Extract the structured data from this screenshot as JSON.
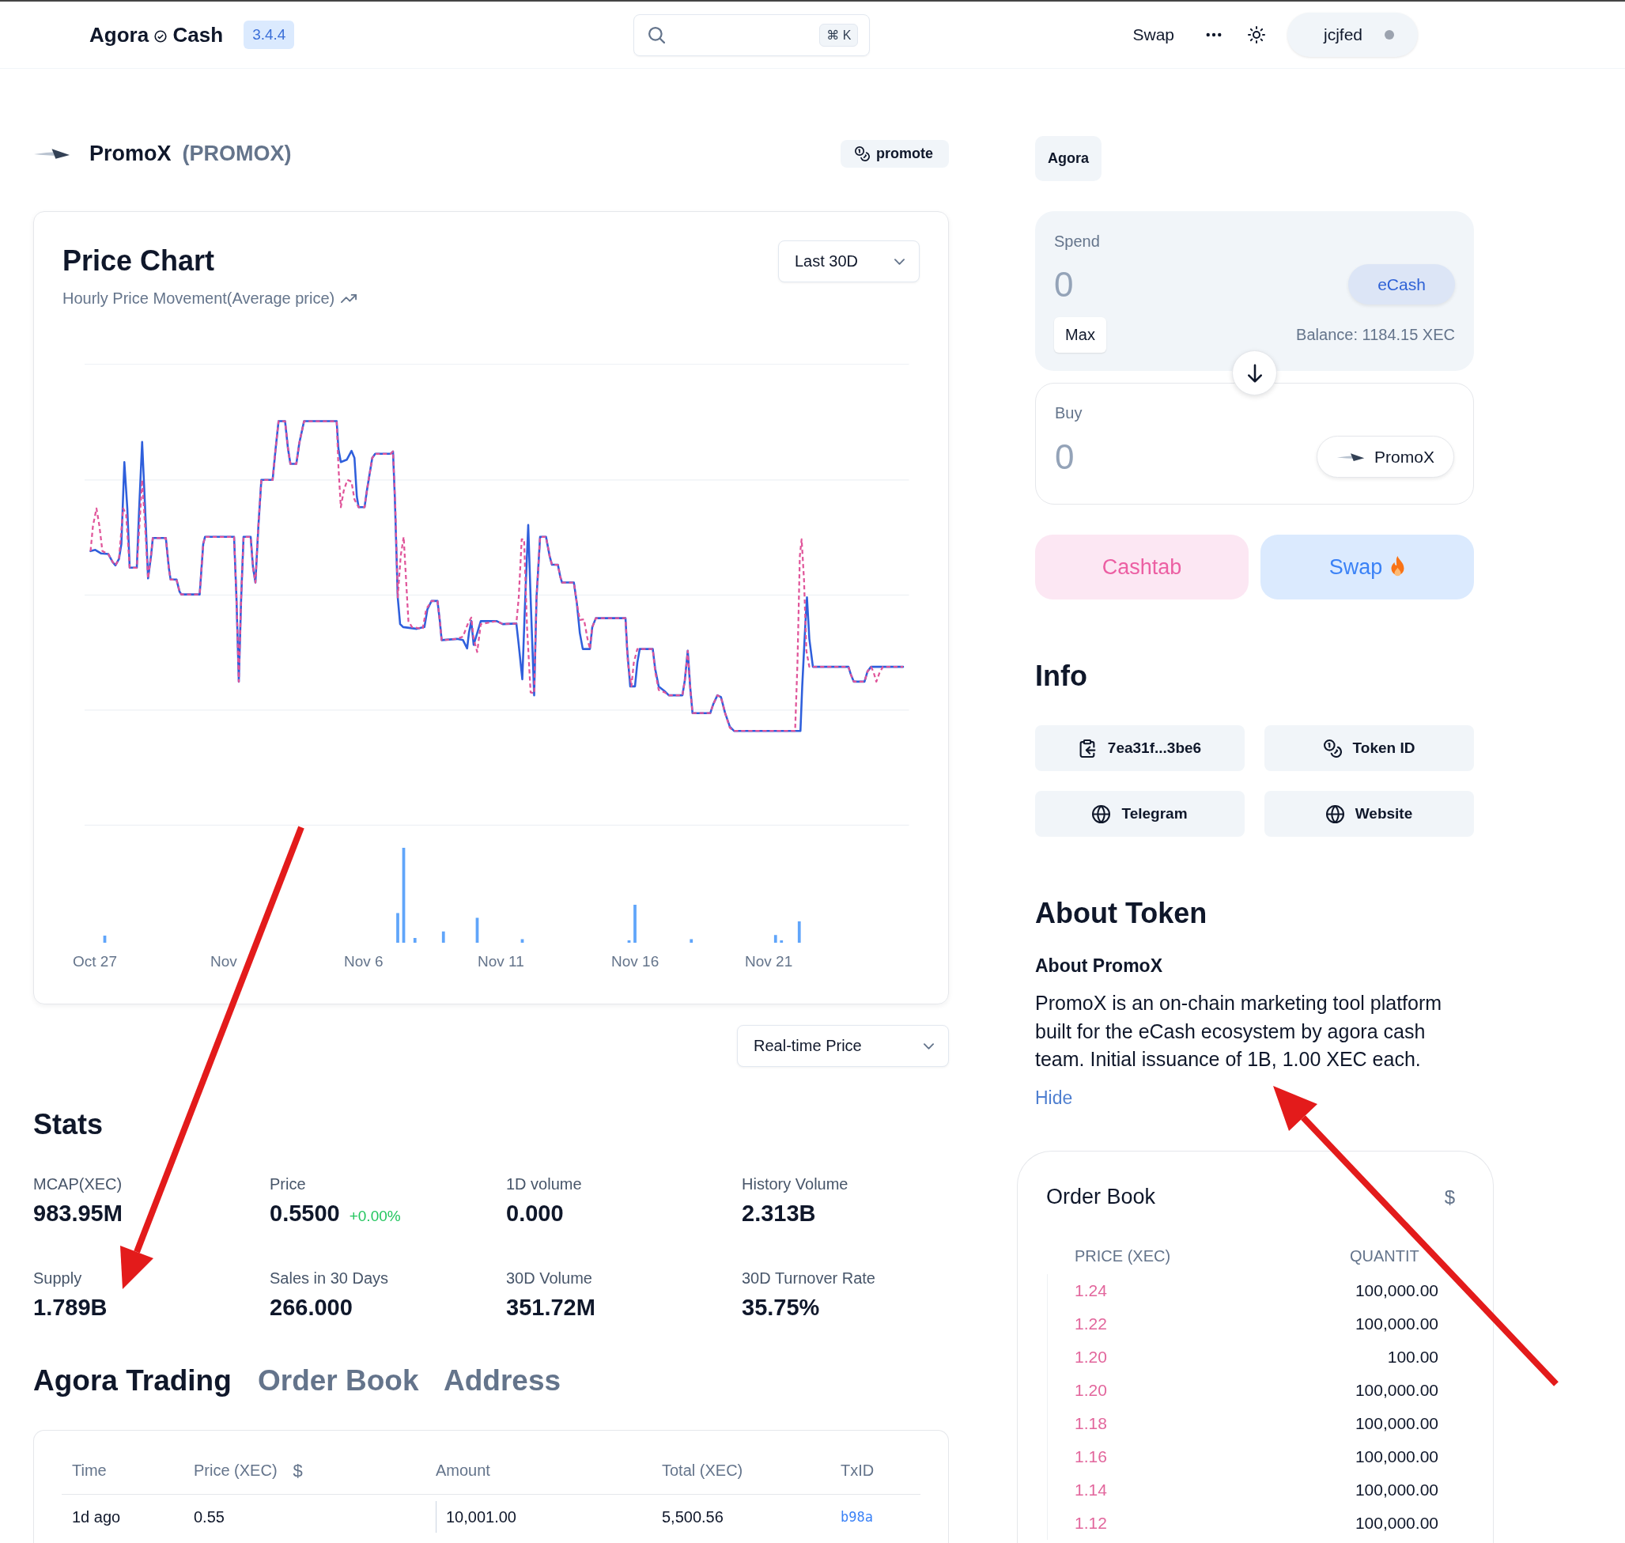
{
  "header": {
    "brand": {
      "first": "Agora",
      "second": "Cash"
    },
    "version": "3.4.4",
    "search": {
      "shortcut": "⌘ K"
    },
    "nav": [
      {
        "label": "Swap"
      }
    ],
    "user": {
      "name": "jcjfed"
    }
  },
  "token": {
    "name": "PromoX",
    "symbol": "(PROMOX)",
    "promote": "promote"
  },
  "price_chart": {
    "title": "Price Chart",
    "subtitle": "Hourly Price Movement(Average price)",
    "range": "Last 30D",
    "x_labels": [
      "Oct 27",
      "Nov",
      "Nov 6",
      "Nov 11",
      "Nov 16",
      "Nov 21"
    ]
  },
  "price_mode": {
    "value": "Real-time Price"
  },
  "stats": {
    "title": "Stats",
    "items": [
      {
        "label": "MCAP(XEC)",
        "value": "983.95M"
      },
      {
        "label": "Price",
        "value": "0.5500",
        "change": "+0.00%"
      },
      {
        "label": "1D volume",
        "value": "0.000"
      },
      {
        "label": "History Volume",
        "value": "2.313B"
      },
      {
        "label": "Supply",
        "value": "1.789B"
      },
      {
        "label": "Sales in 30 Days",
        "value": "266.000"
      },
      {
        "label": "30D Volume",
        "value": "351.72M"
      },
      {
        "label": "30D Turnover Rate",
        "value": "35.75%"
      }
    ]
  },
  "trading": {
    "tabs": [
      {
        "label": "Agora Trading",
        "selected": true
      },
      {
        "label": "Order Book",
        "selected": false
      },
      {
        "label": "Address",
        "selected": false
      }
    ],
    "columns": [
      {
        "label": "Time"
      },
      {
        "label": "Price (XEC)",
        "toggle": "$"
      },
      {
        "label": "Amount"
      },
      {
        "label": "Total (XEC)"
      },
      {
        "label": "TxID"
      }
    ],
    "rows": [
      {
        "time": "1d ago",
        "price": "0.55",
        "amount": "10,001.00",
        "total": "5,500.56",
        "txid": "b98a"
      }
    ]
  },
  "market": {
    "label": "Agora"
  },
  "swap": {
    "spend": {
      "label": "Spend",
      "placeholder": "0",
      "token": "eCash",
      "max": "Max",
      "balance": "Balance: 1184.15 XEC"
    },
    "buy": {
      "label": "Buy",
      "placeholder": "0",
      "token": "PromoX"
    },
    "actions": [
      {
        "label": "Cashtab",
        "kind": "cashtab"
      },
      {
        "label": "Swap",
        "kind": "swap"
      }
    ]
  },
  "info": {
    "title": "Info",
    "links": [
      {
        "label": "7ea31f...3be6",
        "kind": "copy"
      },
      {
        "label": "Token ID",
        "kind": "token"
      },
      {
        "label": "Telegram",
        "kind": "web"
      },
      {
        "label": "Website",
        "kind": "web"
      }
    ]
  },
  "about": {
    "title": "About Token",
    "subtitle": "About PromoX",
    "text": "PromoX is an on-chain marketing tool platform built for the eCash ecosystem by agora cash team. Initial issuance of 1B, 1.00 XEC each.",
    "toggle": "Hide"
  },
  "order_book": {
    "title": "Order Book",
    "currency_toggle": "$",
    "columns": [
      "PRICE (XEC)",
      "QUANTIT"
    ],
    "rows": [
      {
        "price": "1.24",
        "quantity": "100,000.00"
      },
      {
        "price": "1.22",
        "quantity": "100,000.00"
      },
      {
        "price": "1.20",
        "quantity": "100.00"
      },
      {
        "price": "1.20",
        "quantity": "100,000.00"
      },
      {
        "price": "1.18",
        "quantity": "100,000.00"
      },
      {
        "price": "1.16",
        "quantity": "100,000.00"
      },
      {
        "price": "1.14",
        "quantity": "100,000.00"
      },
      {
        "price": "1.12",
        "quantity": "100,000.00"
      }
    ]
  }
}
